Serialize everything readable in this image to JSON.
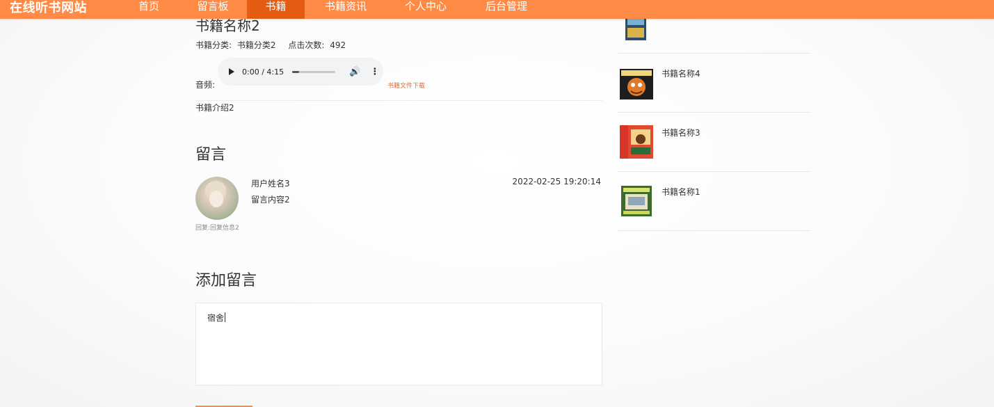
{
  "nav": {
    "brand": "在线听书网站",
    "items": [
      {
        "label": "首页"
      },
      {
        "label": "留言板"
      },
      {
        "label": "书籍"
      },
      {
        "label": "书籍资讯"
      },
      {
        "label": "个人中心"
      },
      {
        "label": "后台管理"
      }
    ],
    "active_index": 2,
    "accent_color": "#ff8a45",
    "active_color": "#e35c12"
  },
  "book": {
    "title": "书籍名称2",
    "category_label": "书籍分类:",
    "category_value": "书籍分类2",
    "clicks_label": "点击次数:",
    "clicks_value": "492",
    "audio_label": "音频:",
    "audio_time": "0:00 / 4:15",
    "audio_progress": 0.0,
    "download_label": "书籍文件下载",
    "intro": "书籍介绍2"
  },
  "comments": {
    "section_title": "留言",
    "items": [
      {
        "user": "用户姓名3",
        "content": "留言内容2",
        "time": "2022-02-25 19:20:14",
        "reply": "回复:回复信息2"
      }
    ]
  },
  "add_comment": {
    "section_title": "添加留言",
    "value": "宿舍"
  },
  "sidebar": {
    "items": [
      {
        "name": "",
        "cover_icon": "book-cover"
      },
      {
        "name": "书籍名称4",
        "cover_icon": "book-cover"
      },
      {
        "name": "书籍名称3",
        "cover_icon": "book-cover"
      },
      {
        "name": "书籍名称1",
        "cover_icon": "book-cover"
      }
    ]
  }
}
